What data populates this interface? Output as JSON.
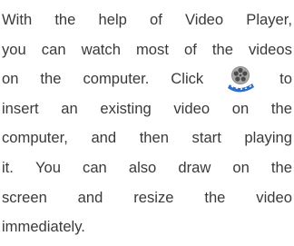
{
  "paragraph": {
    "line1": [
      "With",
      "the",
      "help",
      "of",
      "Video",
      "Player,"
    ],
    "line2": [
      "you",
      "can",
      "watch",
      "most",
      "of",
      "the",
      "videos"
    ],
    "line3_before": [
      "on",
      "the",
      "computer.",
      "Click"
    ],
    "icon": "video-reel-icon",
    "line3_after": [
      "to"
    ],
    "line4": [
      "insert",
      "an",
      "existing",
      "video",
      "on",
      "the"
    ],
    "line5": [
      "computer,",
      "and",
      "then",
      "start",
      "playing"
    ],
    "line6": [
      "it.",
      "You",
      "can",
      "also",
      "draw",
      "on",
      "the"
    ],
    "line7": [
      "screen",
      "and",
      "resize",
      "the",
      "video"
    ],
    "line8": "immediately."
  },
  "colors": {
    "text": "#3a3a3a",
    "icon_blue": "#2f6fc9",
    "icon_reel": "#8a8a8a"
  }
}
